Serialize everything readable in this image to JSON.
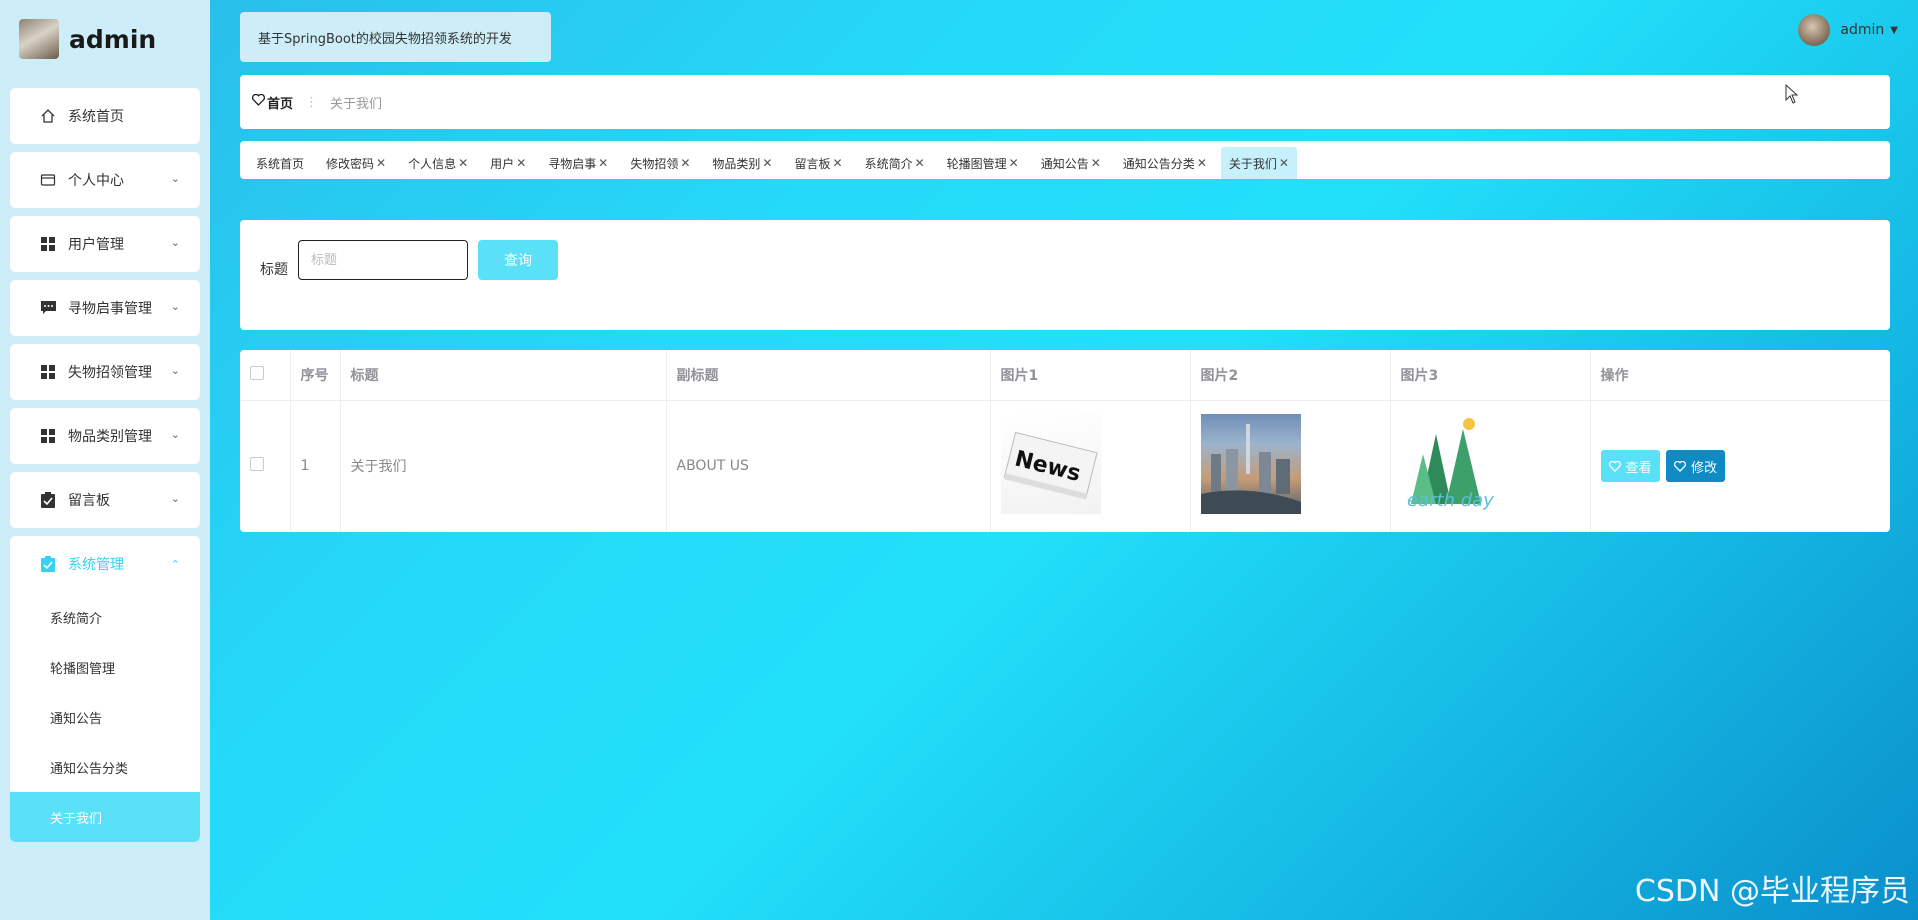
{
  "sidebar": {
    "brand": "admin",
    "items": [
      {
        "label": "系统首页",
        "icon": "home-icon"
      },
      {
        "label": "个人中心",
        "icon": "card-icon"
      },
      {
        "label": "用户管理",
        "icon": "grid-icon"
      },
      {
        "label": "寻物启事管理",
        "icon": "message-icon"
      },
      {
        "label": "失物招领管理",
        "icon": "grid-icon"
      },
      {
        "label": "物品类别管理",
        "icon": "grid-icon"
      },
      {
        "label": "留言板",
        "icon": "clipboard-icon"
      }
    ],
    "expanded_group": {
      "label": "系统管理",
      "icon": "clipboard-icon",
      "children": [
        "系统简介",
        "轮播图管理",
        "通知公告",
        "通知公告分类",
        "关于我们"
      ],
      "active_child": "关于我们"
    }
  },
  "header": {
    "system_title": "基于SpringBoot的校园失物招领系统的开发",
    "user_name": "admin"
  },
  "breadcrumb": {
    "home": "首页",
    "current": "关于我们"
  },
  "tags": [
    {
      "label": "系统首页",
      "closable": false
    },
    {
      "label": "修改密码",
      "closable": true
    },
    {
      "label": "个人信息",
      "closable": true
    },
    {
      "label": "用户",
      "closable": true
    },
    {
      "label": "寻物启事",
      "closable": true
    },
    {
      "label": "失物招领",
      "closable": true
    },
    {
      "label": "物品类别",
      "closable": true
    },
    {
      "label": "留言板",
      "closable": true
    },
    {
      "label": "系统简介",
      "closable": true
    },
    {
      "label": "轮播图管理",
      "closable": true
    },
    {
      "label": "通知公告",
      "closable": true
    },
    {
      "label": "通知公告分类",
      "closable": true
    },
    {
      "label": "关于我们",
      "closable": true,
      "active": true
    }
  ],
  "search": {
    "label": "标题",
    "placeholder": "标题",
    "button": "查询"
  },
  "table": {
    "columns": [
      "序号",
      "标题",
      "副标题",
      "图片1",
      "图片2",
      "图片3",
      "操作"
    ],
    "rows": [
      {
        "index": "1",
        "title": "关于我们",
        "subtitle": "ABOUT US",
        "img1": "news-image",
        "img2": "city-image",
        "img3": "earth-day-image",
        "actions": {
          "view": "查看",
          "edit": "修改"
        }
      }
    ]
  },
  "watermark": "CSDN @毕业程序员",
  "colors": {
    "accent": "#5ae0f7",
    "edit_button": "#0f8bc4",
    "sidebar_bg": "#cdeef8",
    "active_group": "#37d2f1"
  }
}
